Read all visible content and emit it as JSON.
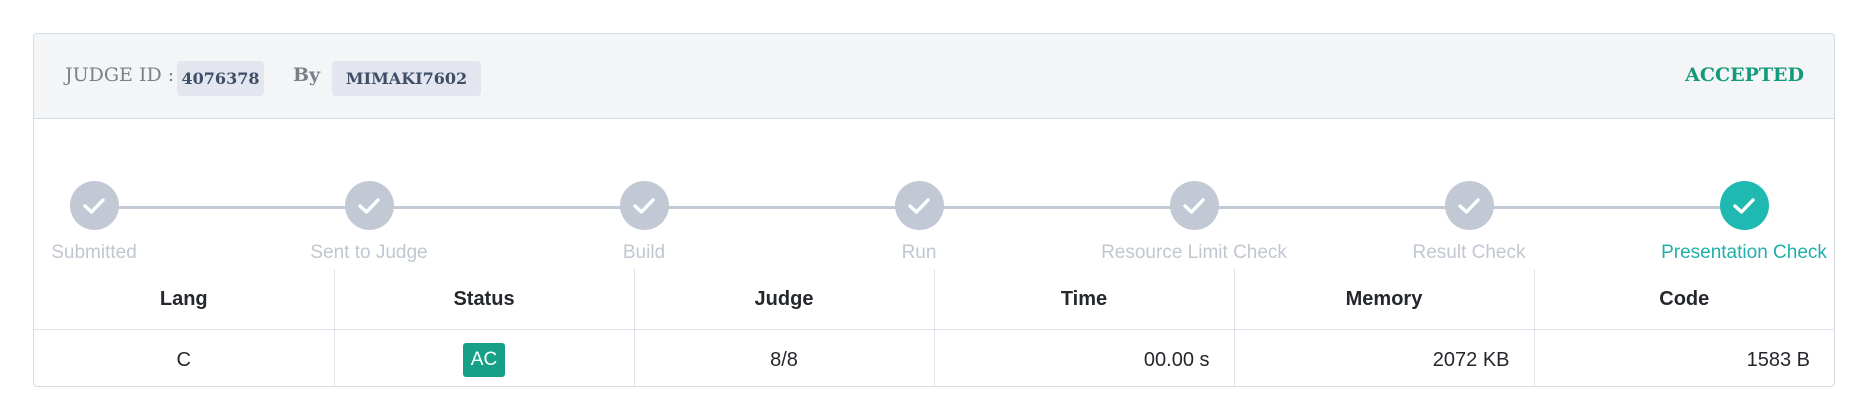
{
  "header": {
    "judge_id_label": "JUDGE ID :",
    "judge_id": "4076378",
    "by_label": "By",
    "user": "MIMAKI7602",
    "verdict": "ACCEPTED",
    "verdict_color": "#13997b"
  },
  "progress": {
    "steps": [
      {
        "label": "Submitted",
        "state": "done"
      },
      {
        "label": "Sent to Judge",
        "state": "done"
      },
      {
        "label": "Build",
        "state": "done"
      },
      {
        "label": "Run",
        "state": "done"
      },
      {
        "label": "Resource Limit Check",
        "state": "done"
      },
      {
        "label": "Result Check",
        "state": "done"
      },
      {
        "label": "Presentation Check",
        "state": "current"
      }
    ],
    "check_icon": "check-icon",
    "active_color": "#1fb9b1"
  },
  "results": {
    "headers": [
      "Lang",
      "Status",
      "Judge",
      "Time",
      "Memory",
      "Code"
    ],
    "row": {
      "lang": "C",
      "status": "AC",
      "judge": "8/8",
      "time": "00.00 s",
      "memory": "2072 KB",
      "code": "1583 B"
    },
    "status_color": "#17a088"
  }
}
